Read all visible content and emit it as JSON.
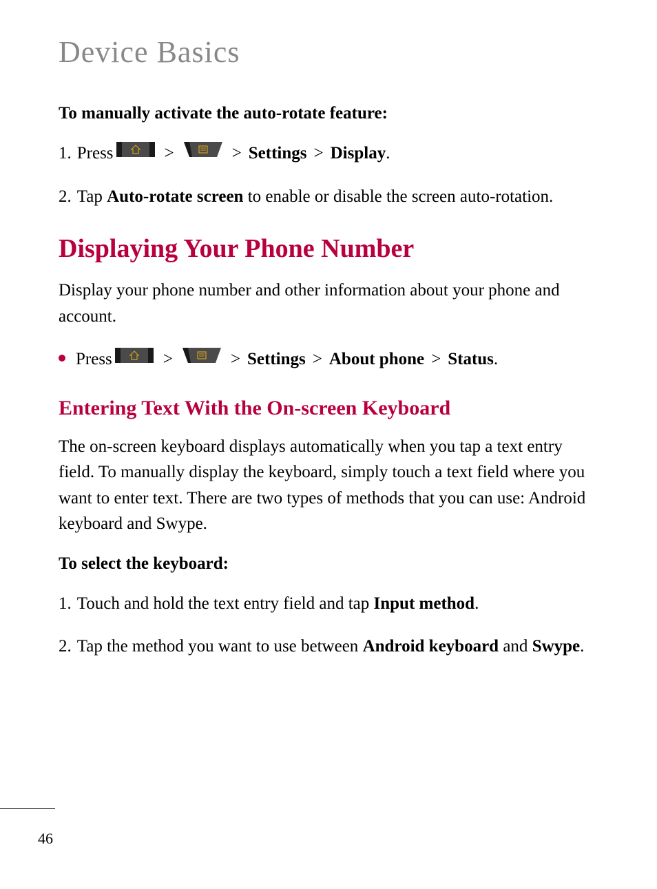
{
  "page_title": "Device Basics",
  "section1": {
    "heading": "To manually activate the auto-rotate feature:",
    "step1": {
      "num": "1.",
      "press": "Press",
      "sep": ">",
      "settings": "Settings",
      "display": "Display",
      "period": "."
    },
    "step2": {
      "num": "2.",
      "tap": "Tap ",
      "autorotate": "Auto-rotate screen",
      "rest": " to enable or disable the screen auto-rotation."
    }
  },
  "section2": {
    "heading": "Displaying Your Phone Number",
    "body": "Display your phone number and other information about your phone and account.",
    "bullet": {
      "press": "Press",
      "sep": ">",
      "settings": "Settings",
      "about": "About phone",
      "status": "Status",
      "period": "."
    }
  },
  "section3": {
    "heading": "Entering Text With the On-screen Keyboard",
    "body": "The on-screen keyboard displays automatically when you tap a text entry field. To manually display the keyboard, simply touch a text field where you want to enter text. There are two types of methods that you can use: Android keyboard and Swype.",
    "subheading": "To select the keyboard:",
    "step1": {
      "num": "1.",
      "part1": "Touch and hold the text entry field and tap ",
      "bold": "Input method",
      "period": "."
    },
    "step2": {
      "num": "2.",
      "part1": "Tap the method you want to use between ",
      "bold1": "Android keyboard",
      "and": " and ",
      "bold2": "Swype",
      "period": "."
    }
  },
  "page_number": "46"
}
